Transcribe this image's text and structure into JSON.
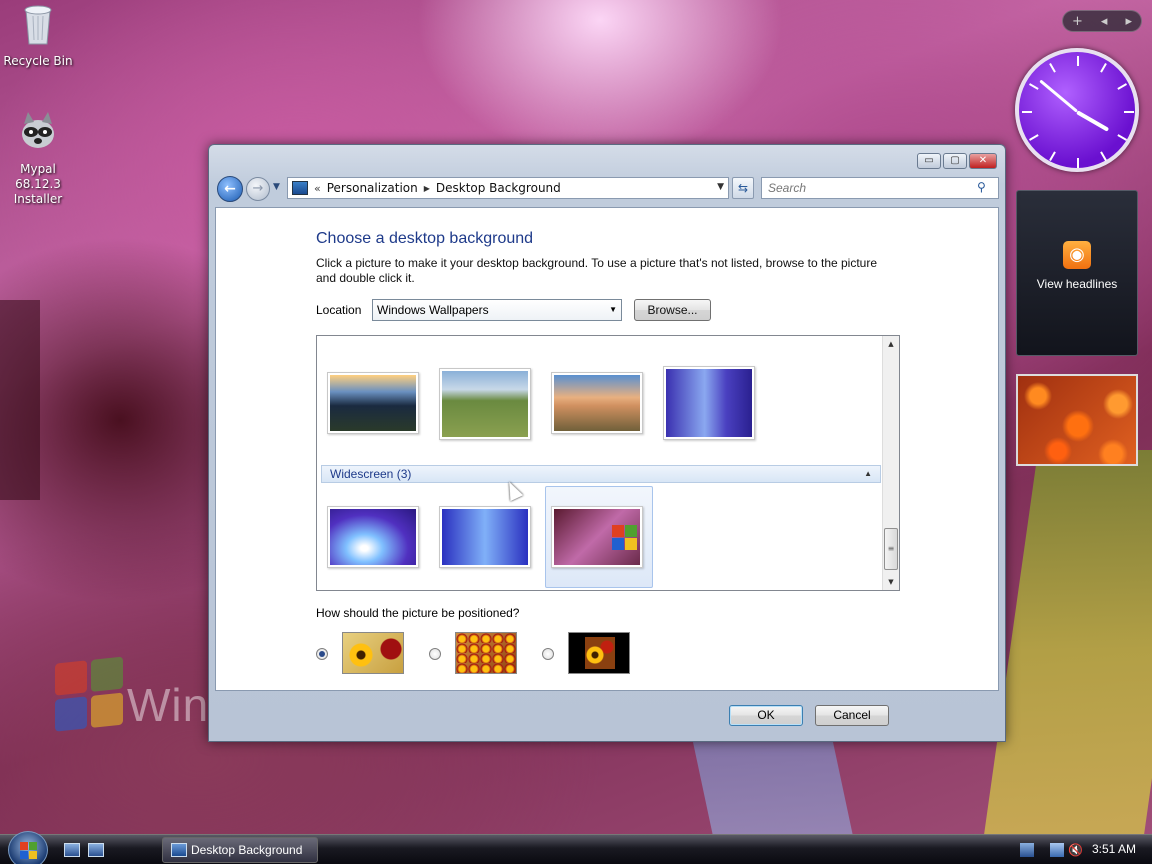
{
  "desktop": {
    "icons": [
      {
        "label": "Recycle Bin",
        "icon": "recycle-bin-icon"
      },
      {
        "label": "Mypal 68.12.3 Installer",
        "icon": "raccoon-installer-icon"
      }
    ],
    "watermark_text": "Wind"
  },
  "sidebar": {
    "clock_time": "3:51",
    "feed_label": "View headlines",
    "controls": [
      "+",
      "◂",
      "▸"
    ]
  },
  "window": {
    "title": "Desktop Background",
    "controls": {
      "minimize": "▭",
      "maximize": "▢",
      "close": "✕"
    },
    "address": {
      "prefix": "«",
      "crumbs": [
        "Personalization",
        "Desktop Background"
      ]
    },
    "search_placeholder": "Search",
    "heading": "Choose a desktop background",
    "description": "Click a picture to make it your desktop background. To use a picture that's not listed, browse to the picture and double click it.",
    "location_label": "Location",
    "location_value": "Windows Wallpapers",
    "browse_label": "Browse...",
    "gallery": {
      "group_label": "Widescreen (3)",
      "top_row": [
        "coastline-sunset",
        "grass-hills",
        "lake-sunset",
        "blue-aurora"
      ],
      "widescreen_row": [
        "purple-rays",
        "blue-aurora-2",
        "vista-tree-logo"
      ],
      "selected": "vista-tree-logo"
    },
    "position_label": "How should the picture be positioned?",
    "position_options": [
      {
        "id": "fit-to-screen",
        "checked": true
      },
      {
        "id": "tile",
        "checked": false
      },
      {
        "id": "center",
        "checked": false
      }
    ],
    "ok_label": "OK",
    "cancel_label": "Cancel"
  },
  "taskbar": {
    "task_label": "Desktop Background",
    "clock": "3:51 AM"
  }
}
